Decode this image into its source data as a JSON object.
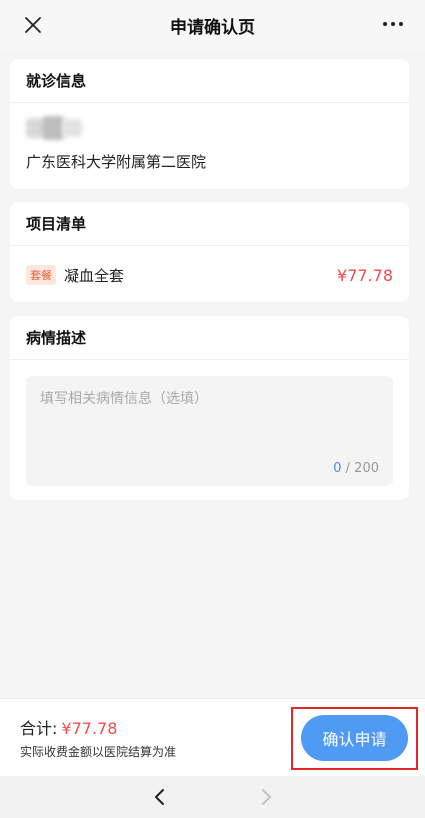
{
  "header": {
    "title": "申请确认页",
    "close_icon": "close-icon",
    "more_icon": "more-dots-icon"
  },
  "visit": {
    "title": "就诊信息",
    "hospital": "广东医科大学附属第二医院"
  },
  "items": {
    "title": "项目清单",
    "list": [
      {
        "tag": "套餐",
        "name": "凝血全套",
        "price": "¥77.78"
      }
    ]
  },
  "description": {
    "title": "病情描述",
    "placeholder": "填写相关病情信息（选填）",
    "count": "0",
    "max": "200"
  },
  "footer": {
    "total_label": "合计:",
    "total_amount": "¥77.78",
    "note": "实际收费金额以医院结算为准",
    "confirm_label": "确认申请"
  },
  "nav": {
    "back_icon": "chevron-left-icon",
    "forward_icon": "chevron-right-icon"
  },
  "colors": {
    "accent": "#4f9af3",
    "price": "#f24d4d",
    "highlight_border": "#e12b2b"
  }
}
